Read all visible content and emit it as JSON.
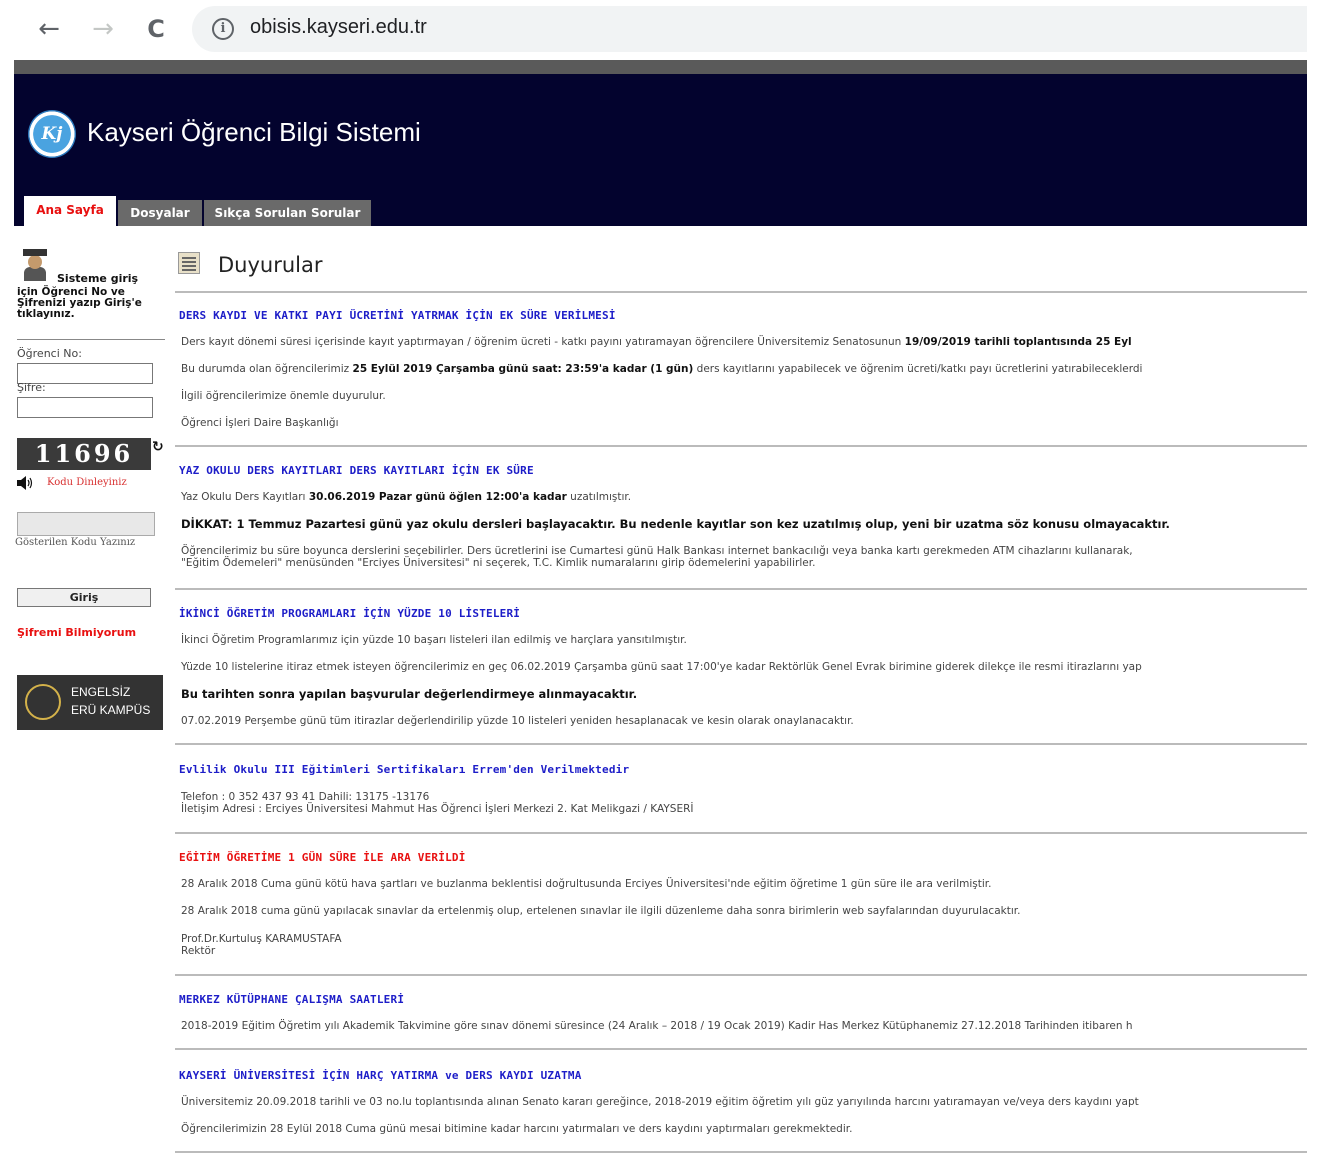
{
  "browser": {
    "back": "←",
    "forward": "→",
    "reload": "C",
    "info": "i",
    "url": "obisis.kayseri.edu.tr"
  },
  "header": {
    "logo_text": "Kj",
    "title": "Kayseri Öğrenci Bilgi Sistemi",
    "tabs": [
      "Ana Sayfa",
      "Dosyalar",
      "Sıkça Sorulan Sorular"
    ]
  },
  "sidebar": {
    "login_title": "Sisteme giriş",
    "login_desc": "için Öğrenci No ve Şifrenizi yazıp Giriş'e tıklayınız.",
    "student_no_label": "Öğrenci No:",
    "password_label": "Şifre:",
    "captcha_code": "11696",
    "listen_label": "Kodu Dinleyiniz",
    "captcha_hint": "Gösterilen Kodu Yazınız",
    "login_button": "Giriş",
    "forgot_password": "Şifremi Bilmiyorum",
    "access_banner_line1": "ENGELSİZ",
    "access_banner_line2": "ERÜ KAMPÜS"
  },
  "main": {
    "title": "Duyurular",
    "announcements": [
      {
        "title": "DERS KAYDI VE KATKI PAYI ÜCRETİNİ YATRMAK İÇİN EK SÜRE VERİLMESİ",
        "p1_a": "Ders kayıt dönemi süresi içerisinde kayıt yaptırmayan / öğrenim ücreti - katkı payını yatıramayan öğrencilere Üniversitemiz Senatosunun ",
        "p1_b": "19/09/2019 tarihli toplantısında 25 Eyl",
        "p2_a": "Bu durumda olan öğrencilerimiz ",
        "p2_b": "25 Eylül 2019 Çarşamba günü saat: 23:59'a kadar (1 gün)",
        "p2_c": " ders kayıtlarını yapabilecek ve öğrenim ücreti/katkı payı ücretlerini yatırabileceklerdi",
        "p3": "İlgili öğrencilerimize önemle duyurulur.",
        "p4": "Öğrenci İşleri Daire Başkanlığı"
      },
      {
        "title": "YAZ OKULU DERS KAYITLARI DERS KAYITLARI İÇİN EK SÜRE",
        "p1_a": "Yaz Okulu Ders Kayıtları ",
        "p1_b": "30.06.2019 Pazar günü öğlen 12:00'a kadar",
        "p1_c": " uzatılmıştır.",
        "bold": "DİKKAT: 1 Temmuz Pazartesi günü yaz okulu dersleri başlayacaktır. Bu nedenle kayıtlar son kez uzatılmış olup, yeni bir uzatma söz konusu olmayacaktır.",
        "p3": "Öğrencilerimiz bu süre boyunca derslerini seçebilirler. Ders ücretlerini ise Cumartesi günü Halk Bankası internet bankacılığı veya banka kartı gerekmeden ATM cihazlarını kullanarak,",
        "p4": "\"Eğitim Ödemeleri\" menüsünden \"Erciyes Üniversitesi\" ni seçerek, T.C. Kimlik numaralarını girip ödemelerini yapabilirler."
      },
      {
        "title": "İKİNCİ ÖĞRETİM PROGRAMLARI İÇİN YÜZDE 10 LİSTELERİ",
        "p1": "İkinci Öğretim Programlarımız için yüzde 10 başarı listeleri ilan edilmiş ve harçlara yansıtılmıştır.",
        "p2": "Yüzde 10 listelerine itiraz etmek isteyen öğrencilerimiz en geç 06.02.2019 Çarşamba günü saat 17:00'ye kadar Rektörlük Genel Evrak birimine giderek dilekçe ile resmi itirazlarını yap",
        "bold": "Bu tarihten sonra yapılan başvurular değerlendirmeye alınmayacaktır.",
        "p4": "07.02.2019 Perşembe günü tüm itirazlar değerlendirilip yüzde 10 listeleri yeniden hesaplanacak ve kesin olarak onaylanacaktır."
      },
      {
        "title": "Evlilik Okulu III Eğitimleri Sertifikaları Errem'den Verilmektedir",
        "p1": "Telefon : 0 352 437 93 41 Dahili: 13175 -13176",
        "p2": "İletişim Adresi : Erciyes Üniversitesi Mahmut Has Öğrenci İşleri Merkezi 2. Kat Melikgazi / KAYSERİ"
      },
      {
        "title": "EĞİTİM ÖĞRETİME 1 GÜN SÜRE İLE ARA VERİLDİ",
        "p1": "28 Aralık 2018 Cuma günü kötü hava şartları ve buzlanma beklentisi doğrultusunda Erciyes Üniversitesi'nde eğitim öğretime 1 gün süre ile ara verilmiştir.",
        "p2": "28 Aralık 2018 cuma günü yapılacak sınavlar da ertelenmiş olup, ertelenen sınavlar ile ilgili düzenleme daha sonra birimlerin web sayfalarından duyurulacaktır.",
        "p3": "Prof.Dr.Kurtuluş KARAMUSTAFA",
        "p4": "Rektör"
      },
      {
        "title": "MERKEZ KÜTÜPHANE ÇALIŞMA SAATLERİ",
        "p1": "2018-2019 Eğitim Öğretim yılı Akademik Takvimine göre sınav dönemi süresince (24 Aralık – 2018 / 19 Ocak 2019) Kadir Has Merkez Kütüphanemiz 27.12.2018 Tarihinden itibaren h"
      },
      {
        "title": "KAYSERİ ÜNİVERSİTESİ İÇİN HARÇ YATIRMA ve DERS KAYDI UZATMA",
        "p1": "Üniversitemiz 20.09.2018 tarihli ve 03 no.lu toplantısında alınan Senato kararı gereğince, 2018-2019 eğitim öğretim yılı güz yarıyılında harcını yatıramayan ve/veya ders kaydını yapt",
        "p2": "Öğrencilerimizin 28 Eylül 2018 Cuma günü mesai bitimine kadar harcını yatırmaları ve ders kaydını yaptırmaları gerekmektedir."
      }
    ]
  },
  "colors": {
    "header_bg": "#03032e",
    "link_blue": "#1d1dc8",
    "alert_red": "#e81010"
  }
}
